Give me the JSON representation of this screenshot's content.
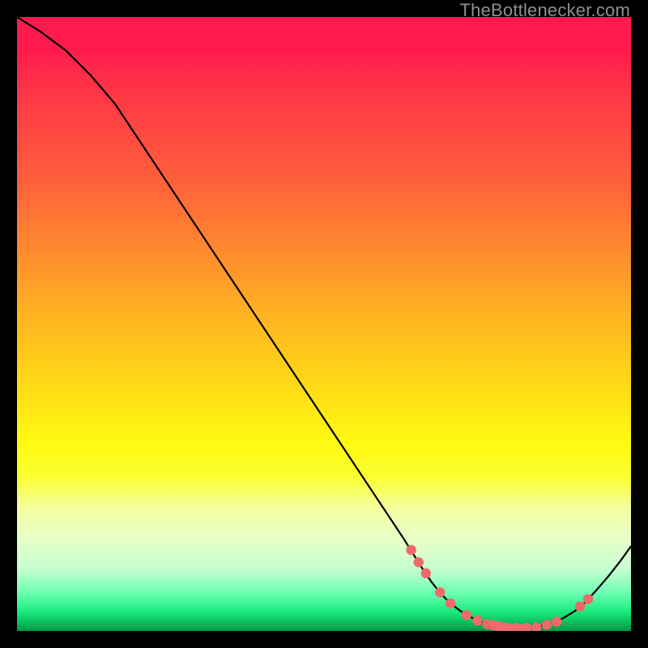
{
  "watermark": "TheBottlenecker.com",
  "chart_data": {
    "type": "line",
    "title": "",
    "xlabel": "",
    "ylabel": "",
    "xlim": [
      0,
      100
    ],
    "ylim": [
      0,
      100
    ],
    "series": [
      {
        "name": "curve",
        "points": [
          {
            "x": 0.0,
            "y": 100.0
          },
          {
            "x": 4.0,
            "y": 97.5
          },
          {
            "x": 8.0,
            "y": 94.5
          },
          {
            "x": 12.0,
            "y": 90.5
          },
          {
            "x": 16.0,
            "y": 85.8
          },
          {
            "x": 63.0,
            "y": 15.0
          },
          {
            "x": 64.5,
            "y": 12.6
          },
          {
            "x": 66.0,
            "y": 10.2
          },
          {
            "x": 67.5,
            "y": 8.0
          },
          {
            "x": 69.0,
            "y": 6.1
          },
          {
            "x": 70.6,
            "y": 4.5
          },
          {
            "x": 72.3,
            "y": 3.2
          },
          {
            "x": 74.2,
            "y": 2.1
          },
          {
            "x": 76.1,
            "y": 1.3
          },
          {
            "x": 78.1,
            "y": 0.8
          },
          {
            "x": 80.2,
            "y": 0.5
          },
          {
            "x": 82.4,
            "y": 0.4
          },
          {
            "x": 84.6,
            "y": 0.6
          },
          {
            "x": 86.7,
            "y": 1.1
          },
          {
            "x": 88.8,
            "y": 2.0
          },
          {
            "x": 90.8,
            "y": 3.2
          },
          {
            "x": 92.7,
            "y": 4.8
          },
          {
            "x": 94.5,
            "y": 6.8
          },
          {
            "x": 96.3,
            "y": 8.9
          },
          {
            "x": 98.2,
            "y": 11.3
          },
          {
            "x": 100.0,
            "y": 13.8
          }
        ]
      },
      {
        "name": "markers",
        "points": [
          {
            "x": 64.2,
            "y": 13.2
          },
          {
            "x": 65.4,
            "y": 11.2
          },
          {
            "x": 66.6,
            "y": 9.4
          },
          {
            "x": 68.9,
            "y": 6.3
          },
          {
            "x": 70.6,
            "y": 4.5
          },
          {
            "x": 73.2,
            "y": 2.6
          },
          {
            "x": 75.0,
            "y": 1.7
          },
          {
            "x": 76.6,
            "y": 1.1
          },
          {
            "x": 77.6,
            "y": 0.9
          },
          {
            "x": 78.4,
            "y": 0.8
          },
          {
            "x": 79.3,
            "y": 0.6
          },
          {
            "x": 80.1,
            "y": 0.5
          },
          {
            "x": 81.2,
            "y": 0.5
          },
          {
            "x": 82.0,
            "y": 0.4
          },
          {
            "x": 83.0,
            "y": 0.5
          },
          {
            "x": 84.6,
            "y": 0.6
          },
          {
            "x": 86.3,
            "y": 1.0
          },
          {
            "x": 87.9,
            "y": 1.5
          },
          {
            "x": 91.7,
            "y": 4.0
          },
          {
            "x": 93.0,
            "y": 5.2
          }
        ]
      }
    ]
  }
}
